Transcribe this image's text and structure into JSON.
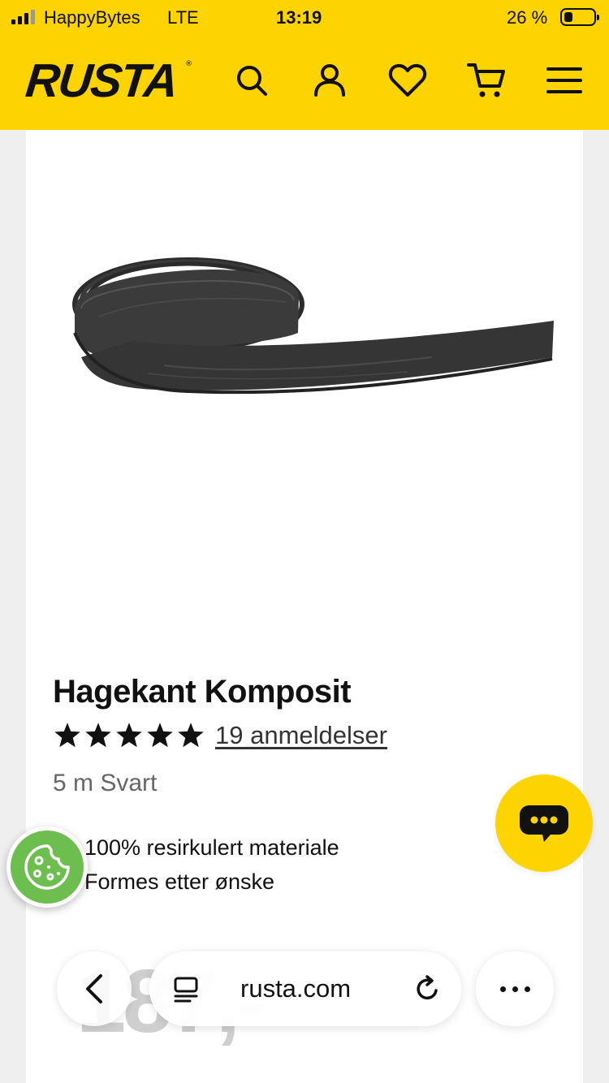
{
  "status_bar": {
    "carrier": "HappyBytes",
    "network": "LTE",
    "time": "13:19",
    "battery_percent": "26 %",
    "battery_level": 0.26
  },
  "header": {
    "logo": "RUSTA",
    "logo_mark": "®",
    "background_color": "#fdd300",
    "icons": [
      "search-icon",
      "account-icon",
      "heart-icon",
      "cart-icon",
      "menu-icon"
    ]
  },
  "product": {
    "title": "Hagekant Komposit",
    "rating": 5,
    "reviews_label": "19 anmeldelser",
    "variant": "5 m Svart",
    "features": [
      "100% resirkulert materiale",
      "Formes etter ønske"
    ],
    "price_partial": "187,-"
  },
  "floating": {
    "chat_icon": "chat-bubble-icon",
    "cookie_icon": "cookie-icon"
  },
  "browser": {
    "url": "rusta.com",
    "icons": [
      "back-chevron-icon",
      "reader-icon",
      "reload-icon",
      "more-icon"
    ]
  }
}
